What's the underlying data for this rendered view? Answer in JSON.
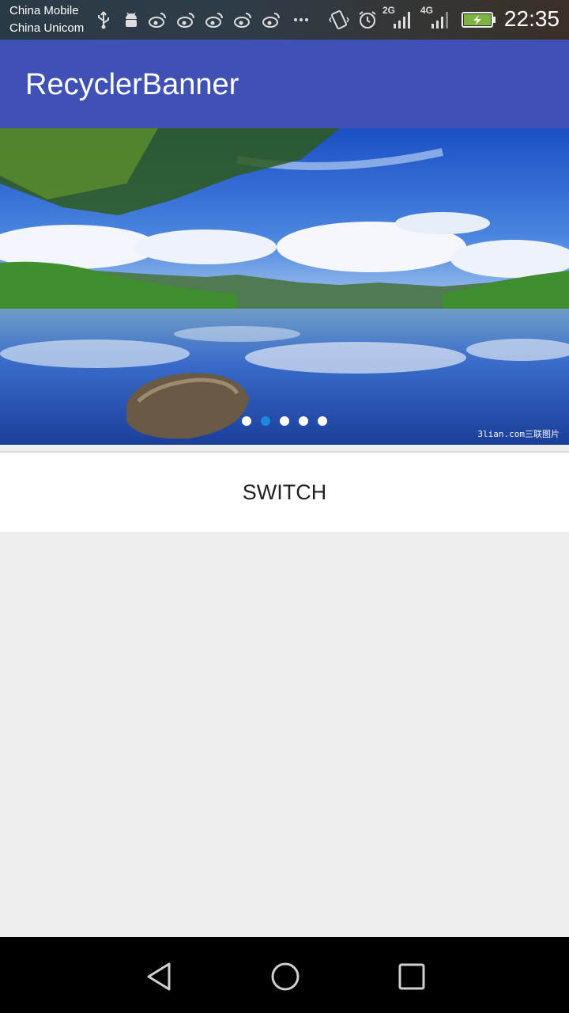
{
  "status_bar": {
    "carrier_1": "China Mobile",
    "carrier_2": "China Unicom",
    "time": "22:35",
    "network_1": "2G",
    "network_2": "4G",
    "notification_icons": [
      "usb-icon",
      "android-icon",
      "weibo-icon",
      "weibo-icon",
      "weibo-icon",
      "weibo-icon",
      "weibo-icon",
      "more-icon"
    ],
    "system_icons": [
      "vibrate-icon",
      "alarm-icon",
      "signal-icon",
      "signal-icon",
      "battery-charging-icon"
    ]
  },
  "app_bar": {
    "title": "RecyclerBanner",
    "color": "#3f51b5"
  },
  "banner": {
    "image_description": "lake landscape",
    "watermark": "3lian.com三联图片",
    "indicator": {
      "count": 5,
      "active_index": 1,
      "active_color": "#1e88e5",
      "inactive_color": "#ffffff"
    }
  },
  "switch_button": {
    "label": "SWITCH"
  },
  "nav_bar": {
    "buttons": [
      "back-icon",
      "home-icon",
      "recents-icon"
    ]
  }
}
